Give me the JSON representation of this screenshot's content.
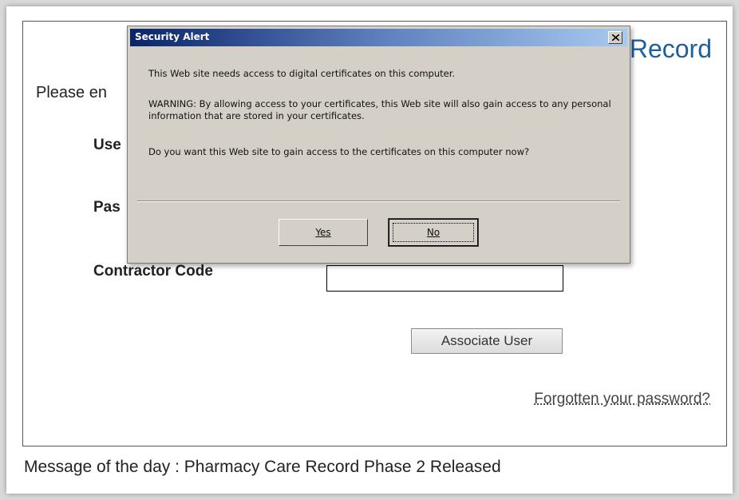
{
  "page": {
    "title_visible": "Record",
    "prompt_visible": "Please en",
    "username_label_visible": "Use",
    "password_label_visible": "Pas",
    "contractor_code_label": "Contractor Code",
    "contractor_code_value": "",
    "associate_button_label": "Associate User",
    "forgot_password_link": "Forgotten your password?",
    "message_of_the_day": "Message of the day : Pharmacy Care Record Phase 2 Released"
  },
  "dialog": {
    "title": "Security Alert",
    "message_1": "This Web site needs access to digital certificates on this computer.",
    "message_2": "WARNING: By allowing access to your certificates, this Web site will also gain access to any personal information that are stored in your certificates.",
    "message_3": "Do you want this Web site to gain access to the certificates on this computer now?",
    "yes_label": "Yes",
    "no_label": "No",
    "close_icon": "close-icon"
  },
  "colors": {
    "title_text": "#1f5f9e",
    "dialog_title_bar_start": "#0a246a",
    "dialog_title_bar_end": "#a6caf0",
    "dialog_background": "#d4d0c8"
  }
}
